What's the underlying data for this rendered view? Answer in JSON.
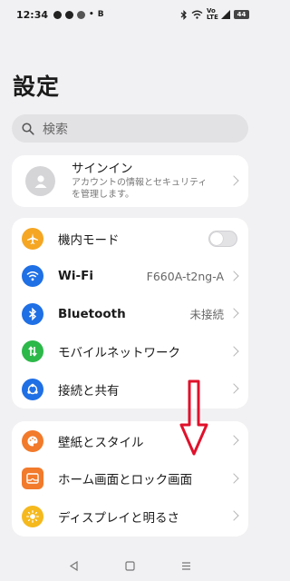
{
  "status": {
    "time": "12:34",
    "vo_lte": "Vo LTE",
    "battery": "44"
  },
  "page_title": "設定",
  "search": {
    "placeholder": "検索"
  },
  "signin": {
    "title": "サインイン",
    "subtitle_line1": "アカウントの情報とセキュリティ",
    "subtitle_line2": "を管理します。"
  },
  "network": [
    {
      "label": "機内モード",
      "value": "",
      "icon": "airplane-icon",
      "color": "#f5a623"
    },
    {
      "label": "Wi-Fi",
      "value": "F660A-t2ng-A",
      "icon": "wifi-icon",
      "color": "#1f6fe5"
    },
    {
      "label": "Bluetooth",
      "value": "未接続",
      "icon": "bluetooth-icon",
      "color": "#1f6fe5"
    },
    {
      "label": "モバイルネットワーク",
      "value": "",
      "icon": "mobile-network-icon",
      "color": "#2db84a"
    },
    {
      "label": "接続と共有",
      "value": "",
      "icon": "share-icon",
      "color": "#1f6fe5"
    }
  ],
  "display": [
    {
      "label": "壁紙とスタイル",
      "icon": "palette-icon",
      "color": "#f27a2b"
    },
    {
      "label": "ホーム画面とロック画面",
      "icon": "home-screen-icon",
      "color": "#f27a2b"
    },
    {
      "label": "ディスプレイと明るさ",
      "icon": "brightness-icon",
      "color": "#f5b91e"
    }
  ],
  "colors": {
    "annotation_arrow": "#e0112b"
  }
}
